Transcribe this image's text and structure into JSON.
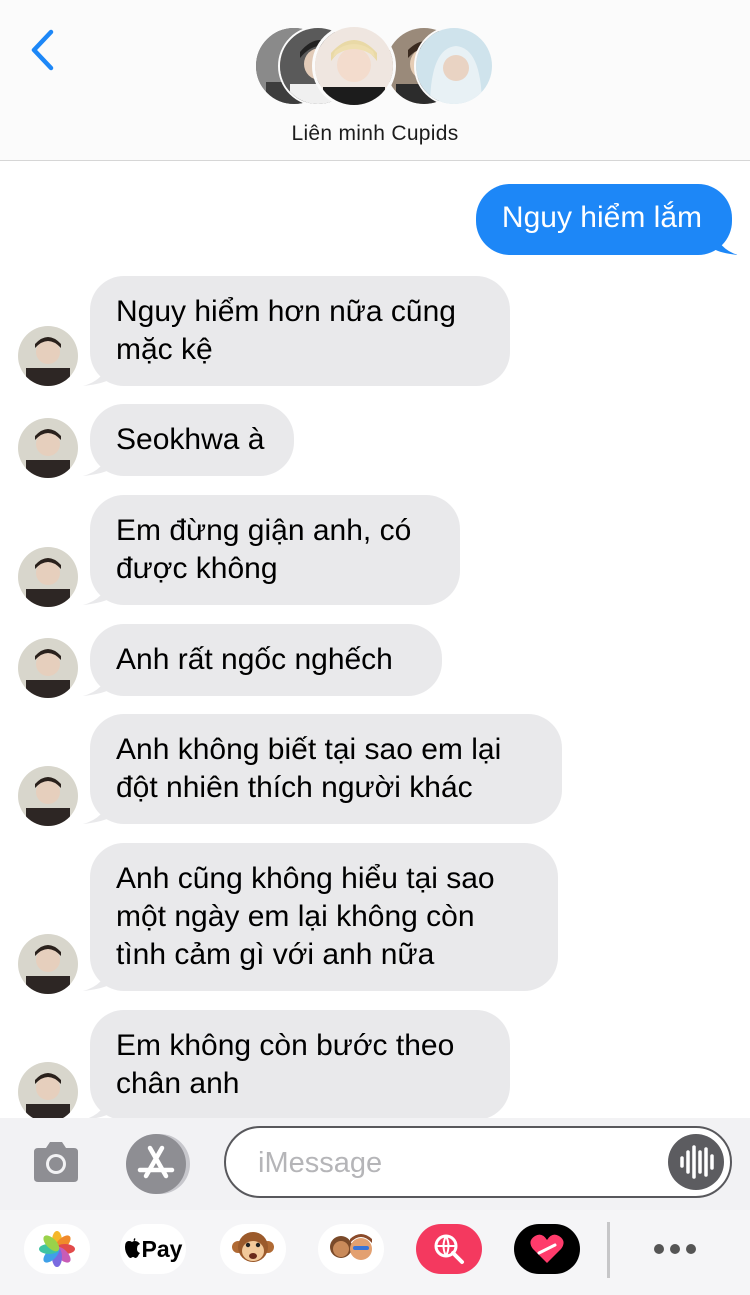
{
  "header": {
    "group_name": "Liên minh Cupids"
  },
  "messages": [
    {
      "direction": "out",
      "text": "Nguy hiểm lắm"
    },
    {
      "direction": "in",
      "text": "Nguy hiểm hơn nữa cũng\nmặc kệ"
    },
    {
      "direction": "in",
      "text": "Seokhwa à"
    },
    {
      "direction": "in",
      "text": "Em đừng giận anh, có\nđược không"
    },
    {
      "direction": "in",
      "text": "Anh rất ngốc nghếch"
    },
    {
      "direction": "in",
      "text": "Anh không biết tại sao em lại\nđột nhiên thích người khác"
    },
    {
      "direction": "in",
      "text": "Anh cũng không hiểu tại sao\nmột ngày em lại không còn\ntình cảm gì với anh nữa"
    },
    {
      "direction": "in",
      "text": "Em không còn bước theo\nchân anh"
    }
  ],
  "composer": {
    "placeholder": "iMessage",
    "value": ""
  },
  "app_drawer": {
    "pay_label": "Pay",
    "items": [
      "photos-app-icon",
      "apple-pay-icon",
      "animoji-monkey-icon",
      "memoji-icon",
      "image-search-icon",
      "digital-touch-icon"
    ]
  },
  "colors": {
    "outgoing_bubble": "#1d87f7",
    "incoming_bubble": "#e9e9eb",
    "accent": "#1d87f7"
  }
}
